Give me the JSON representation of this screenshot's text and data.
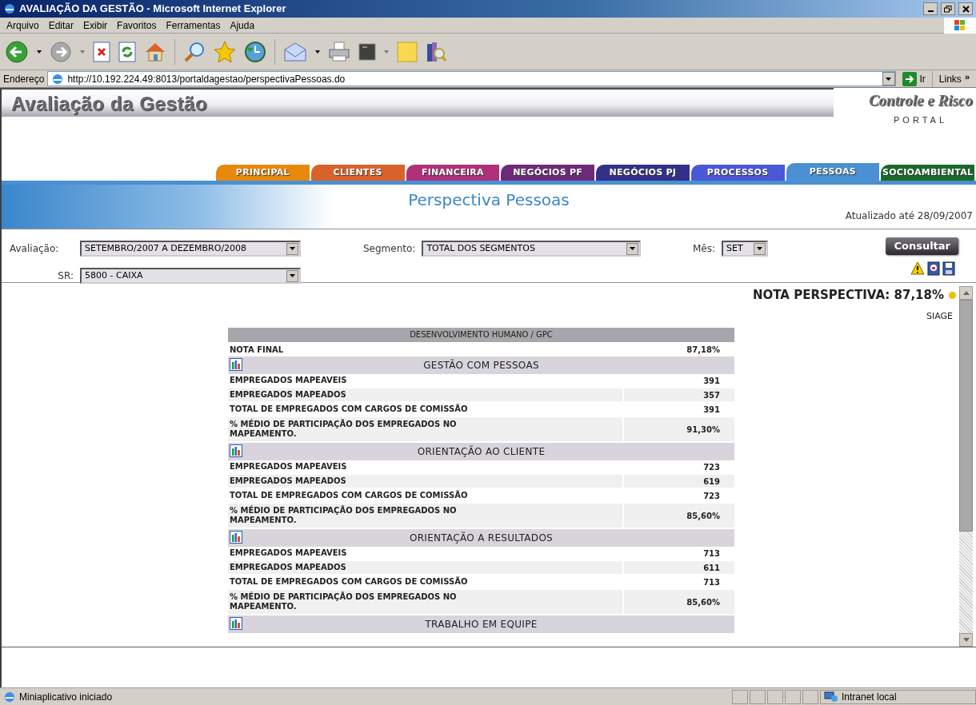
{
  "window": {
    "title": "AVALIAÇÃO DA GESTÃO - Microsoft Internet Explorer"
  },
  "menu": [
    "Arquivo",
    "Editar",
    "Exibir",
    "Favoritos",
    "Ferramentas",
    "Ajuda"
  ],
  "address_bar": {
    "label": "Endereço",
    "url": "http://10.192.224.49:8013/portaldagestao/perspectivaPessoas.do",
    "go": "Ir",
    "links": "Links",
    "links_more": "»"
  },
  "header": {
    "title": "Avaliação da Gestão",
    "brand": "Controle e Risco",
    "subtitle": "PORTAL"
  },
  "tabs": [
    {
      "label": "PRINCIPAL",
      "color": "#e8890c",
      "selected": false
    },
    {
      "label": "CLIENTES",
      "color": "#d9622b",
      "selected": false
    },
    {
      "label": "FINANCEIRA",
      "color": "#b0307a",
      "selected": false
    },
    {
      "label": "NEGÓCIOS PF",
      "color": "#6e2a7a",
      "selected": false
    },
    {
      "label": "NEGÓCIOS PJ",
      "color": "#33308a",
      "selected": false
    },
    {
      "label": "PROCESSOS",
      "color": "#4a58d8",
      "selected": false
    },
    {
      "label": "PESSOAS",
      "color": "#4a90d2",
      "selected": true
    },
    {
      "label": "SOCIOAMBIENTAL",
      "color": "#1a6a2a",
      "selected": false
    }
  ],
  "page_title": "Perspectiva Pessoas",
  "updated": "Atualizado até 28/09/2007",
  "filters": [
    {
      "label": "Avaliação:",
      "value": "SETEMBRO/2007 A DEZEMBRO/2008"
    },
    {
      "label": "Segmento:",
      "value": "TOTAL DOS SEGMENTOS"
    },
    {
      "label": "Mês:",
      "value": "SET"
    },
    {
      "label": "SR:",
      "value": "5800 - CAIXA"
    }
  ],
  "consult_button": "Consultar",
  "nota": {
    "text": "NOTA PERSPECTIVA: 87,18%",
    "color": "#e8c000"
  },
  "source": "SIAGE",
  "table": {
    "title": "DESENVOLVIMENTO HUMANO / GPC",
    "final": {
      "label": "NOTA FINAL",
      "value": "87,18%"
    },
    "sections": [
      {
        "title": "GESTÃO COM PESSOAS",
        "rows": [
          {
            "label": "EMPREGADOS MAPEAVEIS",
            "value": "391"
          },
          {
            "label": "EMPREGADOS MAPEADOS",
            "value": "357"
          },
          {
            "label": "TOTAL DE EMPREGADOS COM CARGOS DE COMISSÃO",
            "value": "391"
          },
          {
            "label": "% MÉDIO DE PARTICIPAÇÃO DOS EMPREGADOS NO MAPEAMENTO.",
            "value": "91,30%"
          }
        ]
      },
      {
        "title": "ORIENTAÇÃO AO CLIENTE",
        "rows": [
          {
            "label": "EMPREGADOS MAPEAVEIS",
            "value": "723"
          },
          {
            "label": "EMPREGADOS MAPEADOS",
            "value": "619"
          },
          {
            "label": "TOTAL DE EMPREGADOS COM CARGOS DE COMISSÃO",
            "value": "723"
          },
          {
            "label": "% MÉDIO DE PARTICIPAÇÃO DOS EMPREGADOS NO MAPEAMENTO.",
            "value": "85,60%"
          }
        ]
      },
      {
        "title": "ORIENTAÇÃO A RESULTADOS",
        "rows": [
          {
            "label": "EMPREGADOS MAPEAVEIS",
            "value": "713"
          },
          {
            "label": "EMPREGADOS MAPEADOS",
            "value": "611"
          },
          {
            "label": "TOTAL DE EMPREGADOS COM CARGOS DE COMISSÃO",
            "value": "713"
          },
          {
            "label": "% MÉDIO DE PARTICIPAÇÃO DOS EMPREGADOS NO MAPEAMENTO.",
            "value": "85,60%"
          }
        ]
      },
      {
        "title": "TRABALHO EM EQUIPE"
      }
    ]
  },
  "status_bar": {
    "text": "Miniaplicativo iniciado",
    "zone": "Intranet local"
  }
}
